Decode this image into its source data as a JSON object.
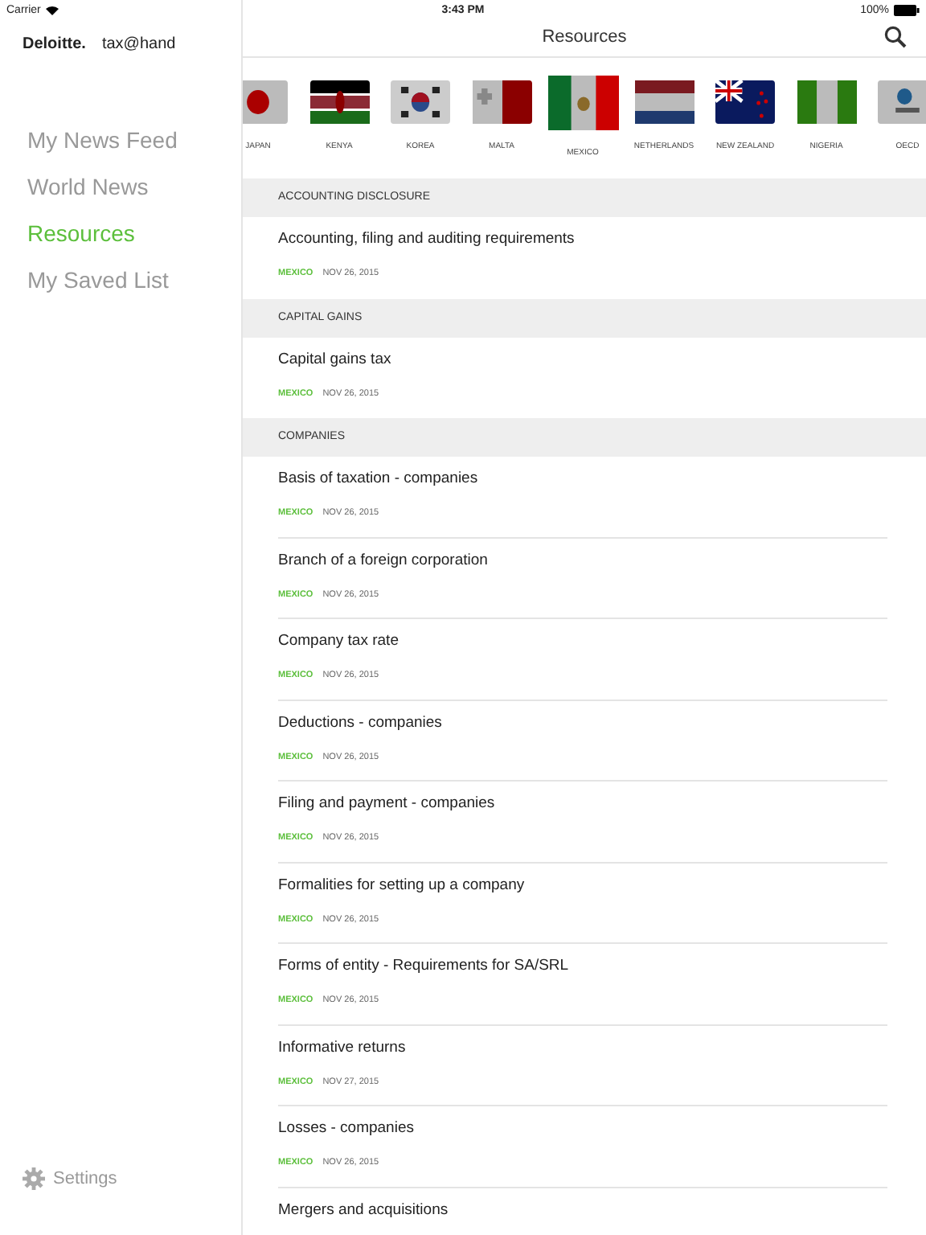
{
  "status_bar": {
    "carrier": "Carrier",
    "time": "3:43 PM",
    "battery": "100%"
  },
  "sidebar": {
    "brand": "Deloitte.",
    "app_name": "tax@hand",
    "items": [
      {
        "label": "My News Feed",
        "selected": false
      },
      {
        "label": "World News",
        "selected": false
      },
      {
        "label": "Resources",
        "selected": true
      },
      {
        "label": "My Saved List",
        "selected": false
      }
    ],
    "settings": "Settings"
  },
  "header": {
    "title": "Resources"
  },
  "flags": [
    {
      "label": "JAPAN",
      "kind": "japan",
      "selected": false
    },
    {
      "label": "KENYA",
      "kind": "kenya",
      "selected": false
    },
    {
      "label": "KOREA",
      "kind": "korea",
      "selected": false
    },
    {
      "label": "MALTA",
      "kind": "malta",
      "selected": false
    },
    {
      "label": "MEXICO",
      "kind": "mexico",
      "selected": true
    },
    {
      "label": "NETHERLANDS",
      "kind": "netherlands",
      "selected": false
    },
    {
      "label": "NEW ZEALAND",
      "kind": "newzealand",
      "selected": false
    },
    {
      "label": "NIGERIA",
      "kind": "nigeria",
      "selected": false
    },
    {
      "label": "OECD",
      "kind": "oecd",
      "selected": false
    }
  ],
  "sections": [
    {
      "title": "ACCOUNTING DISCLOSURE",
      "items": [
        {
          "title": "Accounting, filing and auditing requirements",
          "country": "MEXICO",
          "date": "NOV 26, 2015"
        }
      ]
    },
    {
      "title": "CAPITAL GAINS",
      "items": [
        {
          "title": "Capital gains tax",
          "country": "MEXICO",
          "date": "NOV 26, 2015"
        }
      ]
    },
    {
      "title": "COMPANIES",
      "items": [
        {
          "title": "Basis of taxation - companies",
          "country": "MEXICO",
          "date": "NOV 26, 2015"
        },
        {
          "title": "Branch of a foreign corporation",
          "country": "MEXICO",
          "date": "NOV 26, 2015"
        },
        {
          "title": "Company tax rate",
          "country": "MEXICO",
          "date": "NOV 26, 2015"
        },
        {
          "title": "Deductions - companies",
          "country": "MEXICO",
          "date": "NOV 26, 2015"
        },
        {
          "title": "Filing and payment - companies",
          "country": "MEXICO",
          "date": "NOV 26, 2015"
        },
        {
          "title": "Formalities for setting up a company",
          "country": "MEXICO",
          "date": "NOV 26, 2015"
        },
        {
          "title": "Forms of entity - Requirements for SA/SRL",
          "country": "MEXICO",
          "date": "NOV 26, 2015"
        },
        {
          "title": "Informative returns",
          "country": "MEXICO",
          "date": "NOV 27, 2015"
        },
        {
          "title": "Losses - companies",
          "country": "MEXICO",
          "date": "NOV 26, 2015"
        },
        {
          "title": "Mergers and acquisitions"
        }
      ]
    }
  ]
}
